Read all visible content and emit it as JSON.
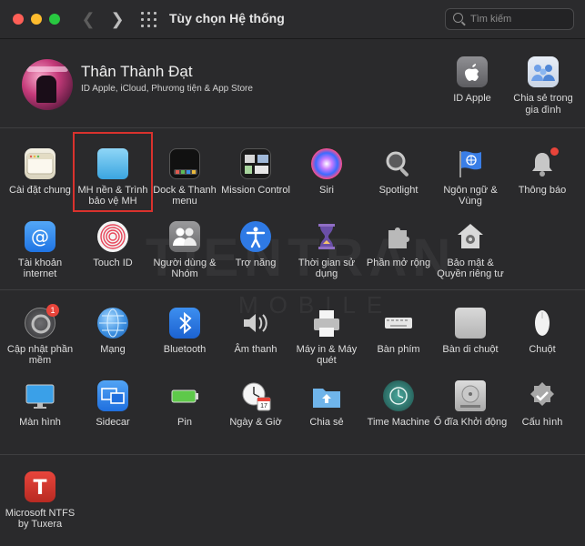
{
  "window": {
    "title": "Tùy chọn Hệ thống"
  },
  "search": {
    "placeholder": "Tìm kiếm"
  },
  "user": {
    "name": "Thân Thành Đạt",
    "subtitle": "ID Apple, iCloud, Phương tiện & App Store"
  },
  "account_items": [
    {
      "label": "ID Apple",
      "icon": "apple-id-icon"
    },
    {
      "label": "Chia sẻ trong gia đình",
      "icon": "family-sharing-icon"
    }
  ],
  "row1": [
    {
      "label": "Cài đặt chung",
      "icon": "general-icon"
    },
    {
      "label": "MH nền & Trình bảo vệ MH",
      "icon": "desktop-screensaver-icon"
    },
    {
      "label": "Dock & Thanh menu",
      "icon": "dock-icon"
    },
    {
      "label": "Mission Control",
      "icon": "mission-control-icon"
    },
    {
      "label": "Siri",
      "icon": "siri-icon"
    },
    {
      "label": "Spotlight",
      "icon": "spotlight-icon"
    },
    {
      "label": "Ngôn ngữ & Vùng",
      "icon": "language-region-icon"
    },
    {
      "label": "Thông báo",
      "icon": "notifications-icon"
    }
  ],
  "row2": [
    {
      "label": "Tài khoản internet",
      "icon": "internet-accounts-icon"
    },
    {
      "label": "Touch ID",
      "icon": "touch-id-icon"
    },
    {
      "label": "Người dùng & Nhóm",
      "icon": "users-groups-icon"
    },
    {
      "label": "Trợ năng",
      "icon": "accessibility-icon"
    },
    {
      "label": "Thời gian sử dụng",
      "icon": "screen-time-icon"
    },
    {
      "label": "Phần mở rộng",
      "icon": "extensions-icon"
    },
    {
      "label": "Bảo mật & Quyền riêng tư",
      "icon": "security-privacy-icon"
    }
  ],
  "row3": [
    {
      "label": "Cập nhật phần mềm",
      "icon": "software-update-icon",
      "badge": "1"
    },
    {
      "label": "Mạng",
      "icon": "network-icon"
    },
    {
      "label": "Bluetooth",
      "icon": "bluetooth-icon"
    },
    {
      "label": "Âm thanh",
      "icon": "sound-icon"
    },
    {
      "label": "Máy in & Máy quét",
      "icon": "printers-icon"
    },
    {
      "label": "Bàn phím",
      "icon": "keyboard-icon"
    },
    {
      "label": "Bàn di chuột",
      "icon": "trackpad-icon"
    },
    {
      "label": "Chuột",
      "icon": "mouse-icon"
    }
  ],
  "row4": [
    {
      "label": "Màn hình",
      "icon": "displays-icon"
    },
    {
      "label": "Sidecar",
      "icon": "sidecar-icon"
    },
    {
      "label": "Pin",
      "icon": "battery-icon"
    },
    {
      "label": "Ngày & Giờ",
      "icon": "date-time-icon",
      "calendar_day": "17"
    },
    {
      "label": "Chia sẻ",
      "icon": "sharing-icon"
    },
    {
      "label": "Time Machine",
      "icon": "time-machine-icon"
    },
    {
      "label": "Ổ đĩa Khởi động",
      "icon": "startup-disk-icon"
    },
    {
      "label": "Cấu hình",
      "icon": "profiles-icon"
    }
  ],
  "row5": [
    {
      "label": "Microsoft NTFS by Tuxera",
      "icon": "tuxera-ntfs-icon"
    }
  ],
  "watermark": {
    "line1": "TIENTRAN",
    "line2": "MOBILE"
  },
  "colors": {
    "highlight": "#d9322d",
    "badge": "#e8443a",
    "window_bg": "#2a2a2c"
  }
}
